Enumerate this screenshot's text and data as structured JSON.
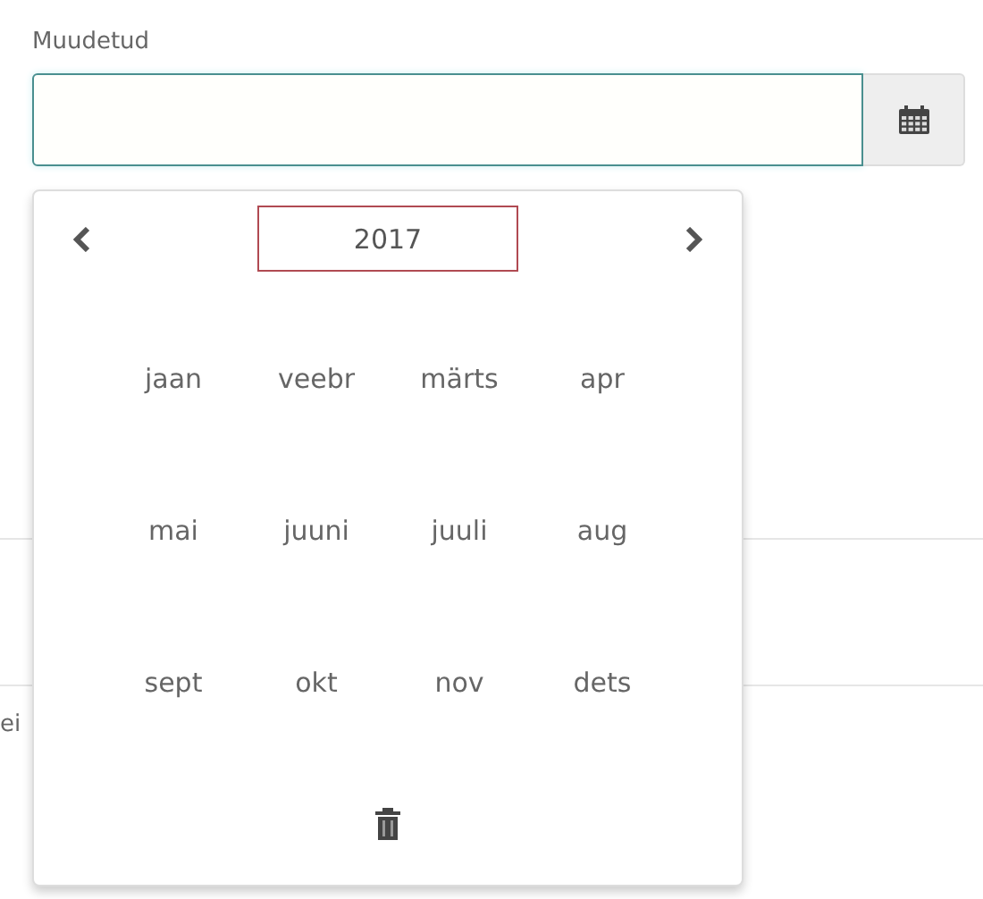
{
  "field": {
    "label": "Muudetud"
  },
  "picker": {
    "year": "2017",
    "months": [
      "jaan",
      "veebr",
      "märts",
      "apr",
      "mai",
      "juuni",
      "juuli",
      "aug",
      "sept",
      "okt",
      "nov",
      "dets"
    ]
  },
  "background_text": "ei"
}
